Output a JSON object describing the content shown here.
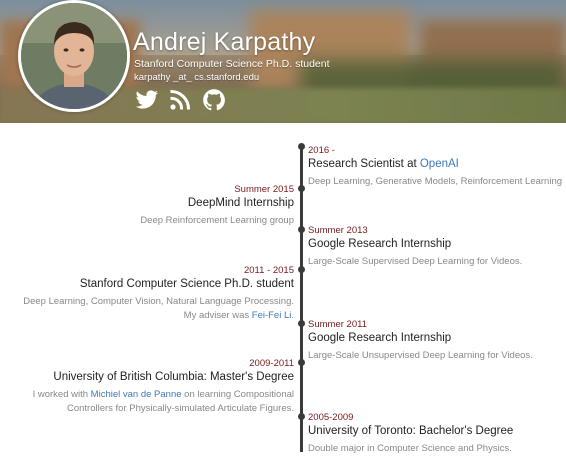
{
  "profile": {
    "name": "Andrej Karpathy",
    "subtitle": "Stanford Computer Science Ph.D. student",
    "email": "karpathy _at_ cs.stanford.edu",
    "social": [
      "twitter-icon",
      "rss-icon",
      "github-icon"
    ]
  },
  "timeline": [
    {
      "side": "right",
      "date": "2016 -",
      "title_pre": "Research Scientist at ",
      "title_link": "OpenAI",
      "desc": "Deep Learning, Generative Models, Reinforcement Learning"
    },
    {
      "side": "left",
      "date": "Summer 2015",
      "title": "DeepMind Internship",
      "desc": "Deep Reinforcement Learning group"
    },
    {
      "side": "right",
      "date": "Summer 2013",
      "title": "Google Research Internship",
      "desc": "Large-Scale Supervised Deep Learning for Videos."
    },
    {
      "side": "left",
      "date": "2011 - 2015",
      "title": "Stanford Computer Science Ph.D. student",
      "desc_line1": "Deep Learning, Computer Vision, Natural Language Processing.",
      "desc_line2_pre": "My adviser was ",
      "desc_line2_link": "Fei-Fei Li",
      "desc_line2_post": "."
    },
    {
      "side": "right",
      "date": "Summer 2011",
      "title": "Google Research Internship",
      "desc": "Large-Scale Unsupervised Deep Learning for Videos."
    },
    {
      "side": "left",
      "date": "2009-2011",
      "title": "University of British Columbia: Master's Degree",
      "desc_line1_pre": "I worked with ",
      "desc_line1_link": "Michiel van de Panne",
      "desc_line1_post": " on learning Compositional",
      "desc_line2": "Controllers for Physically-simulated Articulate Figures."
    },
    {
      "side": "right",
      "date": "2005-2009",
      "title": "University of Toronto: Bachelor's Degree",
      "desc": "Double major in Computer Science and Physics."
    }
  ],
  "colors": {
    "date": "#7a1a1a",
    "link": "#3d7ab8",
    "axis": "#3a3a3a"
  }
}
